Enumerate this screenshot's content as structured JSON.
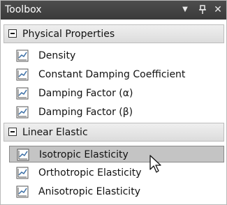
{
  "window": {
    "title": "Toolbox",
    "dropdown_glyph": "▾",
    "pin_glyph": "ᵖ",
    "close_glyph": "×"
  },
  "categories": [
    {
      "label": "Physical Properties",
      "expanded": true,
      "items": [
        {
          "label": "Density",
          "icon": "chart-graph-icon",
          "selected": false
        },
        {
          "label": "Constant Damping Coefficient",
          "icon": "chart-graph-icon",
          "selected": false
        },
        {
          "label": "Damping Factor (α)",
          "icon": "chart-graph-icon",
          "selected": false
        },
        {
          "label": "Damping Factor (β)",
          "icon": "chart-graph-icon",
          "selected": false
        }
      ]
    },
    {
      "label": "Linear Elastic",
      "expanded": true,
      "items": [
        {
          "label": "Isotropic Elasticity",
          "icon": "chart-graph-icon",
          "selected": true
        },
        {
          "label": "Orthotropic Elasticity",
          "icon": "chart-graph-icon",
          "selected": false
        },
        {
          "label": "Anisotropic Elasticity",
          "icon": "chart-graph-icon",
          "selected": false
        }
      ]
    }
  ],
  "colors": {
    "titlebar": "#3f3f3f",
    "category_bg": "#e4e4e4",
    "selected_bg": "#c4c4c4"
  }
}
